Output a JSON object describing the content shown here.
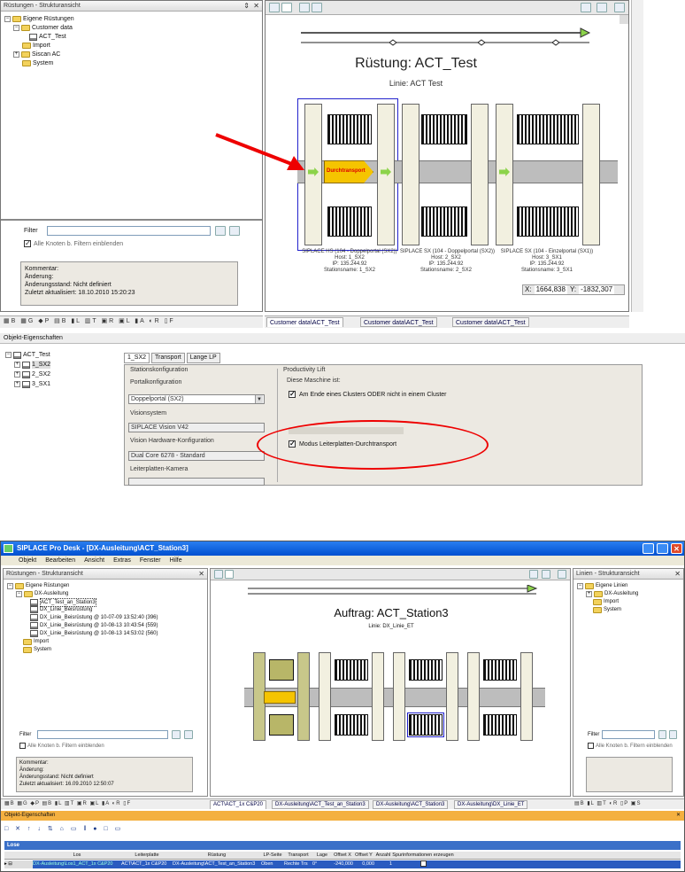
{
  "top": {
    "left_panel": {
      "title": "Rüstungen - Strukturansicht",
      "tree": [
        "Eigene Rüstungen",
        "Customer data",
        "ACT_Test",
        "Import",
        "Siscan AC",
        "System"
      ],
      "filter_label": "Filter",
      "filter_value": "",
      "filter_checkbox": "Alle Knoten b. Filtern einblenden",
      "info": [
        "Kommentar:",
        "Änderung:",
        "Änderungsstand: Nicht definiert",
        "Zuletzt aktualisiert: 18.10.2010 15:20:23"
      ]
    },
    "canvas": {
      "title": "Rüstung: ACT_Test",
      "line": "Linie: ACT Test",
      "transport_label": "Durchtransport",
      "station_lines": [
        [
          "SIPLACE HS (104 - Doppelportal (SX2))",
          "Host: 1_SX2",
          "IP: 135.244.92",
          "Stationsname: 1_SX2"
        ],
        [
          "SIPLACE SX (104 - Doppelportal (SX2))",
          "Host: 2_SX2",
          "IP: 135.244.92",
          "Stationsname: 2_SX2"
        ],
        [
          "SIPLACE SX (104 - Einzelportal (SX1))",
          "Host: 3_SX1",
          "IP: 135.244.92",
          "Stationsname: 3_SX1"
        ]
      ],
      "coord_x_label": "X:",
      "coord_x": "1664,838",
      "coord_y_label": "Y:",
      "coord_y": "-1832,307"
    },
    "tabs": [
      "Customer data\\ACT_Test",
      "Customer data\\ACT_Test",
      "Customer data\\ACT_Test"
    ],
    "props_title": "Objekt-Eigenschaften",
    "props_tree": [
      "ACT_Test",
      "1_SX2",
      "2_SX2",
      "3_SX1"
    ],
    "props_tabs": [
      "1_SX2",
      "Transport",
      "Lange LP"
    ],
    "station_config": {
      "group_title": "Stationskonfiguration",
      "portal_label": "Portalkonfiguration",
      "portal_value": "Doppelportal (SX2)",
      "vision_label": "Visionsystem",
      "vision_value": "SIPLACE Vision V42",
      "hw_label": "Vision Hardware-Konfiguration",
      "hw_value": "Dual Core 6278 - Standard",
      "cam_label": "Leiterplatten-Kamera"
    },
    "productivity": {
      "group_title": "Productivity Lift",
      "desc": "Diese Maschine ist:",
      "opt1": "Am Ende eines Clusters ODER nicht in einem Cluster",
      "opt2": "Modus Leiterplatten-Durchtransport"
    }
  },
  "bottom": {
    "app_title": "SIPLACE Pro Desk - [DX-Ausleitung\\ACT_Station3]",
    "menu": [
      "Objekt",
      "Bearbeiten",
      "Ansicht",
      "Extras",
      "Fenster",
      "Hilfe"
    ],
    "left_panel": {
      "title": "Rüstungen - Strukturansicht",
      "tree": [
        "Eigene Rüstungen",
        "DX-Ausleitung",
        "ACT_Test_an_Station3",
        "DX_Linie_Beisrüstung",
        "DX_Linie_Beisrüstung @ 10-07-09 13:52:40 (396)",
        "DX_Linie_Beisrüstung @ 10-08-13 10:43:54 (559)",
        "DX_Linie_Beisrüstung @ 10-08-13 14:53:02 (560)",
        "Import",
        "System"
      ],
      "filter_label": "Filter",
      "filter_checkbox": "Alle Knoten b. Filtern einblenden",
      "info": [
        "Kommentar:",
        "Änderung:",
        "Änderungsstand: Nicht definiert",
        "Zuletzt aktualisiert: 16.09.2010 12:50:07"
      ]
    },
    "canvas": {
      "title": "Auftrag: ACT_Station3",
      "line": "Linie: DX_Linie_ET"
    },
    "right_panel": {
      "title": "Linien - Strukturansicht",
      "tree": [
        "Eigene Linien",
        "DX-Ausleitung",
        "Import",
        "System"
      ],
      "filter_label": "Filter",
      "filter_checkbox": "Alle Knoten b. Filtern einblenden"
    },
    "tabs": [
      "ACT\\ACT_1x C&P20",
      "DX-Ausleitung\\ACT_Test_an_Station3",
      "DX-Ausleitung\\ACT_Station3",
      "DX-Ausleitung\\DX_Linie_ET"
    ],
    "props_title": "Objekt-Eigenschaften",
    "lose_title": "Lose",
    "table_headers": [
      "Los",
      "Leiterplatte",
      "Rüstung",
      "LP-Seite",
      "Transport",
      "Lage",
      "Offset X",
      "Offset Y",
      "Anzahl",
      "Spurinformationen erzeugen"
    ],
    "table_row": [
      "DX-Ausleitung\\Los1_ACT_1x C&P20",
      "ACT\\ACT_1x C&P20",
      "DX-Ausleitung\\ACT_Test_an_Station3",
      "Oben",
      "Rechte Trs",
      "0°",
      "-240,000",
      "0,000",
      "1",
      ""
    ]
  }
}
